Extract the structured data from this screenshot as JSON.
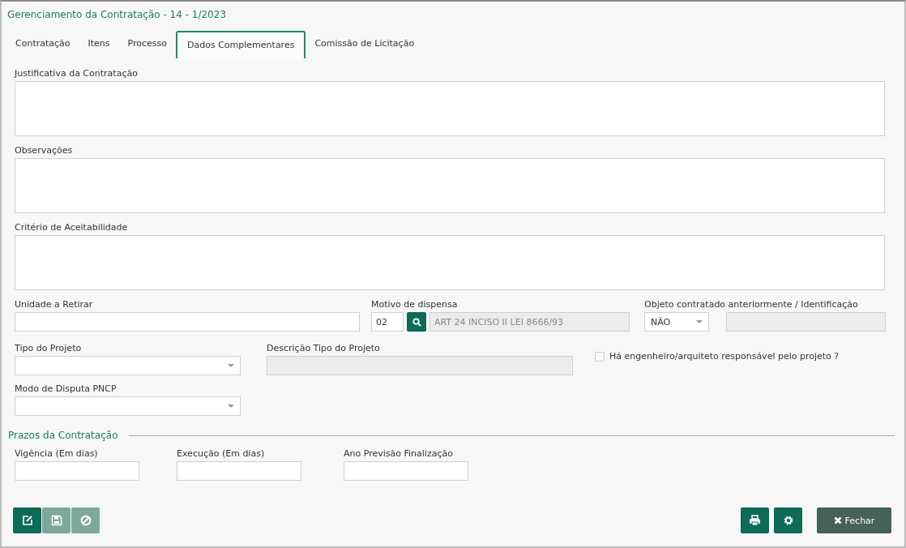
{
  "window": {
    "title": "Gerenciamento da Contratação - 14 - 1/2023"
  },
  "tabs": [
    {
      "label": "Contratação",
      "selected": false
    },
    {
      "label": "Itens",
      "selected": false
    },
    {
      "label": "Processo",
      "selected": false
    },
    {
      "label": "Dados Complementares",
      "selected": true
    },
    {
      "label": "Comissão de Licitação",
      "selected": false
    }
  ],
  "text_areas": [
    {
      "label": "Justificativa da Contratação"
    },
    {
      "label": "Observações"
    },
    {
      "label": "Critério de Aceitabilidade"
    }
  ],
  "unidade": {
    "label": "Unidade a Retirar"
  },
  "motivo": {
    "label": "Motivo de dispensa",
    "code": "02",
    "description": "ART 24 INCISO II LEI 8666/93"
  },
  "objeto": {
    "label": "Objeto contratado anteriormente / Identificação",
    "value": "NÃO"
  },
  "tipo_projeto": {
    "label": "Tipo do Projeto"
  },
  "descricao_tipo": {
    "label": "Descrição Tipo do Projeto"
  },
  "engenheiro": {
    "label": "Há engenheiro/arquiteto responsável pelo projeto ?",
    "checked": false
  },
  "modo_disputa": {
    "label": "Modo de Disputa PNCP"
  },
  "prazos": {
    "title": "Prazos da Contratação",
    "fields": [
      {
        "label": "Vigência (Em dias)"
      },
      {
        "label": "Execução (Em dias)"
      },
      {
        "label": "Ano Previsão Finalização"
      }
    ]
  },
  "toolbar_left": [
    {
      "kind": "edit",
      "disabled": false
    },
    {
      "kind": "save",
      "disabled": true
    },
    {
      "kind": "cancel",
      "disabled": true
    }
  ],
  "toolbar_right": [
    {
      "kind": "print"
    },
    {
      "kind": "settings"
    }
  ],
  "close_button": {
    "label": "Fechar"
  }
}
